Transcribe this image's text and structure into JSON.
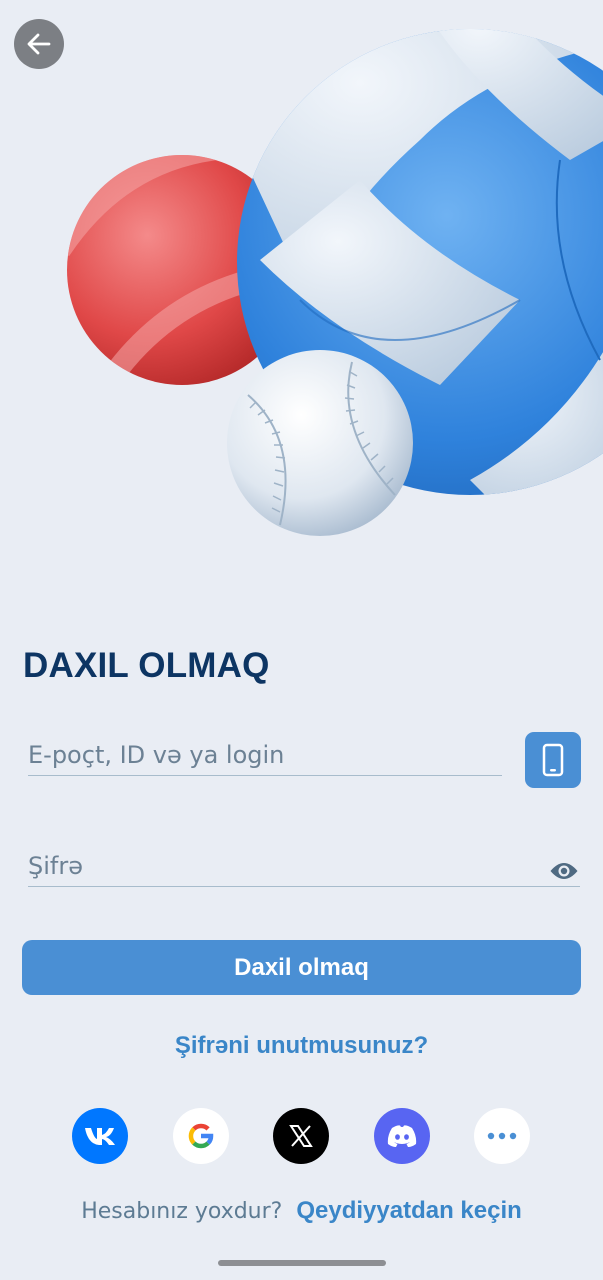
{
  "header": {
    "back_icon": "arrow-left-icon"
  },
  "hero": {
    "illustration": "sports-balls"
  },
  "page": {
    "title": "DAXIL OLMAQ"
  },
  "form": {
    "email_placeholder": "E-poçt, ID və ya login",
    "email_value": "",
    "phone_icon": "smartphone-icon",
    "password_placeholder": "Şifrə",
    "password_value": "",
    "eye_icon": "eye-icon",
    "submit_label": "Daxil olmaq"
  },
  "forgot_password": "Şifrəni unutmusunuz?",
  "social": [
    {
      "name": "vk-icon",
      "color": "#0077ff"
    },
    {
      "name": "google-icon",
      "color": "#ffffff"
    },
    {
      "name": "x-icon",
      "color": "#000000"
    },
    {
      "name": "discord-icon",
      "color": "#5865f2"
    },
    {
      "name": "more-icon",
      "color": "#ffffff"
    }
  ],
  "register": {
    "question": "Hesabınız yoxdur?",
    "link": "Qeydiyyatdan keçin"
  },
  "colors": {
    "background": "#e9edf4",
    "accent": "#4a8fd4",
    "title": "#0d3563",
    "link": "#3a86c8"
  }
}
